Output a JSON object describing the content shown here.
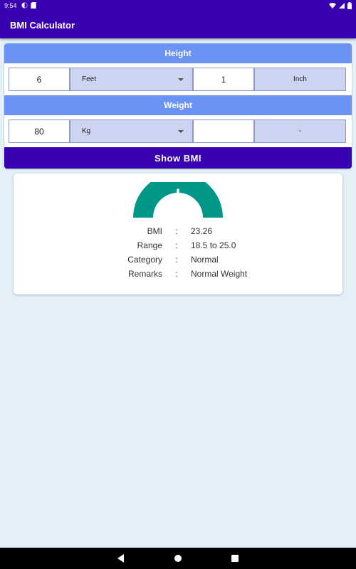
{
  "status_bar": {
    "time": "9:54",
    "icons": [
      "app-notification-icon",
      "sim-card-icon"
    ],
    "right_icons": [
      "wifi-icon",
      "signal-icon",
      "battery-icon"
    ]
  },
  "app_bar": {
    "title": "BMI Calculator"
  },
  "height_section": {
    "header": "Height",
    "primary_value": "6",
    "primary_unit": "Feet",
    "secondary_value": "1",
    "secondary_unit": "Inch"
  },
  "weight_section": {
    "header": "Weight",
    "primary_value": "80",
    "primary_unit": "Kg",
    "secondary_value": "",
    "secondary_unit": "-"
  },
  "show_button": {
    "label": "Show BMI"
  },
  "result": {
    "gauge_color": "#009688",
    "rows": [
      {
        "label": "BMI",
        "sep": ":",
        "value": "23.26"
      },
      {
        "label": "Range",
        "sep": ":",
        "value": "18.5 to 25.0"
      },
      {
        "label": "Category",
        "sep": ":",
        "value": "Normal"
      },
      {
        "label": "Remarks",
        "sep": ":",
        "value": "Normal Weight"
      }
    ]
  },
  "colors": {
    "primary": "#3800b0",
    "section_header": "#6b93f5",
    "unit_bg": "#ccd4f2",
    "background": "#e3f0f8"
  }
}
